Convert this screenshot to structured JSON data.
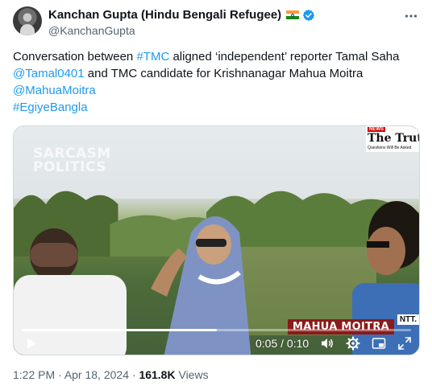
{
  "author": {
    "display_name": "Kanchan Gupta (Hindu Bengali Refugee)",
    "handle": "@KanchanGupta",
    "flag_icon": "india-flag-icon",
    "verified_icon": "verified-badge-icon"
  },
  "tweet": {
    "line1_prefix": "Conversation between ",
    "hashtag_tmc": "#TMC",
    "line1_suffix": " aligned ‘independent’ reporter Tamal Saha",
    "mention_tamal": "@Tamal0401",
    "line2_suffix": " and TMC candidate for Krishnanagar Mahua Moitra",
    "mention_mahua": "@MahuaMoitra",
    "hashtag_egiye": "#EgiyeBangla"
  },
  "video": {
    "watermark_line1": "SARCASM",
    "watermark_line2": "POLITICS",
    "logo_news": "NEWS",
    "logo_title": "The Truth",
    "logo_tagline": "Questions Will Be Asked",
    "name_banner": "MAHUA MOITRA",
    "channel_tag": "NTT.",
    "elapsed": "0:05",
    "separator": " / ",
    "duration": "0:10",
    "progress_fraction": 0.5
  },
  "meta": {
    "time": "1:22 PM",
    "dot1": " · ",
    "date": "Apr 18, 2024",
    "dot2": " · ",
    "views_count": "161.8K",
    "views_label": " Views"
  },
  "colors": {
    "link": "#1d9bf0",
    "muted": "#536471",
    "verified": "#1d9bf0"
  }
}
